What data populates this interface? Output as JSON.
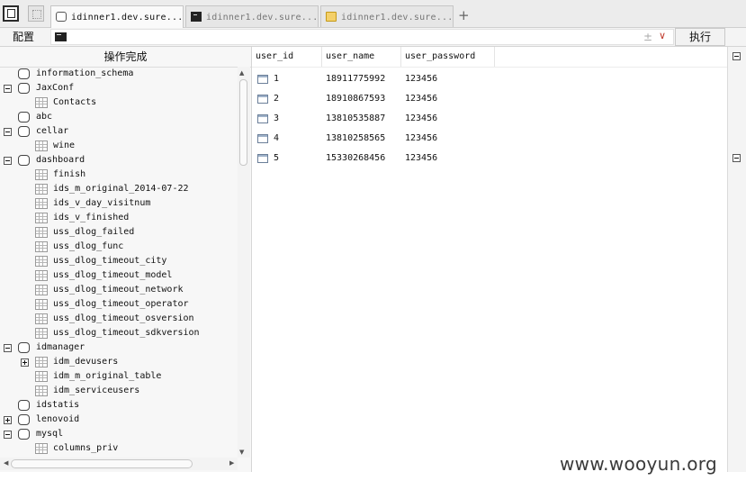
{
  "tabs": [
    {
      "label": "idinner1.dev.sure...",
      "icon": "database-icon",
      "active": true
    },
    {
      "label": "idinner1.dev.sure...",
      "icon": "terminal-icon",
      "active": false
    },
    {
      "label": "idinner1.dev.sure...",
      "icon": "folder-icon",
      "active": false
    }
  ],
  "new_tab_label": "+",
  "toolbar": {
    "config_label": "配置",
    "command_value": "",
    "plusminus": "±",
    "dropdown": "∨",
    "execute_label": "执行"
  },
  "left_panel": {
    "header": "操作完成",
    "tree": [
      {
        "label": "information_schema",
        "type": "db",
        "toggle": "none",
        "depth": 0
      },
      {
        "label": "JaxConf",
        "type": "db",
        "toggle": "minus",
        "depth": 0
      },
      {
        "label": "Contacts",
        "type": "table",
        "toggle": "none",
        "depth": 1
      },
      {
        "label": "abc",
        "type": "db",
        "toggle": "none",
        "depth": 0
      },
      {
        "label": "cellar",
        "type": "db",
        "toggle": "minus",
        "depth": 0
      },
      {
        "label": "wine",
        "type": "table",
        "toggle": "none",
        "depth": 1
      },
      {
        "label": "dashboard",
        "type": "db",
        "toggle": "minus",
        "depth": 0
      },
      {
        "label": "finish",
        "type": "table",
        "toggle": "none",
        "depth": 1
      },
      {
        "label": "ids_m_original_2014-07-22",
        "type": "table",
        "toggle": "none",
        "depth": 1
      },
      {
        "label": "ids_v_day_visitnum",
        "type": "table",
        "toggle": "none",
        "depth": 1
      },
      {
        "label": "ids_v_finished",
        "type": "table",
        "toggle": "none",
        "depth": 1
      },
      {
        "label": "uss_dlog_failed",
        "type": "table",
        "toggle": "none",
        "depth": 1
      },
      {
        "label": "uss_dlog_func",
        "type": "table",
        "toggle": "none",
        "depth": 1
      },
      {
        "label": "uss_dlog_timeout_city",
        "type": "table",
        "toggle": "none",
        "depth": 1
      },
      {
        "label": "uss_dlog_timeout_model",
        "type": "table",
        "toggle": "none",
        "depth": 1
      },
      {
        "label": "uss_dlog_timeout_network",
        "type": "table",
        "toggle": "none",
        "depth": 1
      },
      {
        "label": "uss_dlog_timeout_operator",
        "type": "table",
        "toggle": "none",
        "depth": 1
      },
      {
        "label": "uss_dlog_timeout_osversion",
        "type": "table",
        "toggle": "none",
        "depth": 1
      },
      {
        "label": "uss_dlog_timeout_sdkversion",
        "type": "table",
        "toggle": "none",
        "depth": 1
      },
      {
        "label": "idmanager",
        "type": "db",
        "toggle": "minus",
        "depth": 0
      },
      {
        "label": "idm_devusers",
        "type": "table",
        "toggle": "plus",
        "depth": 1
      },
      {
        "label": "idm_m_original_table",
        "type": "table",
        "toggle": "none",
        "depth": 1
      },
      {
        "label": "idm_serviceusers",
        "type": "table",
        "toggle": "none",
        "depth": 1
      },
      {
        "label": "idstatis",
        "type": "db",
        "toggle": "none",
        "depth": 0
      },
      {
        "label": "lenovoid",
        "type": "db",
        "toggle": "plus",
        "depth": 0
      },
      {
        "label": "mysql",
        "type": "db",
        "toggle": "minus",
        "depth": 0
      },
      {
        "label": "columns_priv",
        "type": "table",
        "toggle": "none",
        "depth": 1
      },
      {
        "label": "",
        "type": "table",
        "toggle": "none",
        "depth": 1
      }
    ]
  },
  "grid": {
    "columns": [
      "user_id",
      "user_name",
      "user_password"
    ],
    "rows": [
      [
        "1",
        "18911775992",
        "123456"
      ],
      [
        "2",
        "18910867593",
        "123456"
      ],
      [
        "3",
        "13810535887",
        "123456"
      ],
      [
        "4",
        "13810258565",
        "123456"
      ],
      [
        "5",
        "15330268456",
        "123456"
      ]
    ]
  },
  "watermark": "www.wooyun.org"
}
